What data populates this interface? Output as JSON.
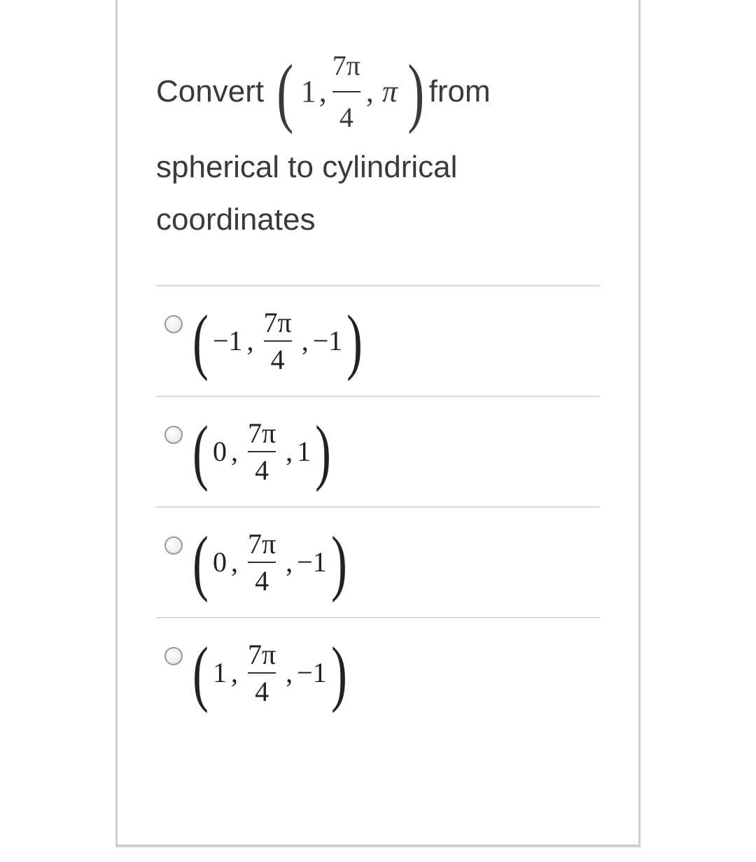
{
  "question": {
    "prefix": "Convert",
    "tuple": {
      "a": "1",
      "b_num": "7π",
      "b_den": "4",
      "c": "π"
    },
    "suffix1": "from",
    "line2": "spherical to cylindrical",
    "line3": "coordinates"
  },
  "options": [
    {
      "a": "−1",
      "b_num": "7π",
      "b_den": "4",
      "c": "−1"
    },
    {
      "a": "0",
      "b_num": "7π",
      "b_den": "4",
      "c": "1"
    },
    {
      "a": "0",
      "b_num": "7π",
      "b_den": "4",
      "c": "−1"
    },
    {
      "a": "1",
      "b_num": "7π",
      "b_den": "4",
      "c": "−1"
    }
  ]
}
